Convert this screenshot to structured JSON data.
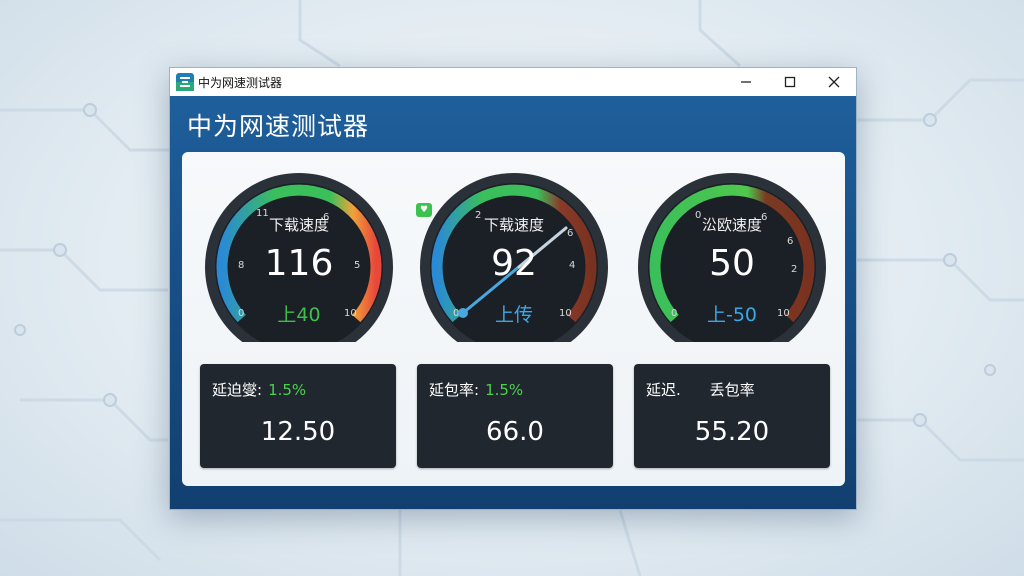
{
  "window": {
    "title": "中为网速测试器",
    "controls": [
      "minimize",
      "maximize",
      "close"
    ]
  },
  "app": {
    "heading": "中为网速测试器"
  },
  "gauges": [
    {
      "label": "下载速度",
      "value": "116",
      "sub_label": "上40",
      "sub_color": "#3fbf4a",
      "ticks": [
        "11",
        "6",
        "8",
        "5",
        "0",
        "10"
      ]
    },
    {
      "label": "下载速度",
      "value": "92",
      "sub_label": "上传",
      "sub_color": "#3aa7e6",
      "ticks": [
        "2",
        "6",
        "4",
        "0",
        "10"
      ]
    },
    {
      "label": "㳂欧速度",
      "value": "50",
      "sub_label": "上-50",
      "sub_color": "#3aa7e6",
      "ticks": [
        "0",
        "6",
        "6",
        "2",
        "0",
        "10"
      ]
    }
  ],
  "status_badge": {
    "icon": "heart-icon"
  },
  "cards": [
    {
      "label": "延迫燮:",
      "pct": "1.5%",
      "value": "12.50"
    },
    {
      "label": "延包率:",
      "pct": "1.5%",
      "value": "66.0"
    },
    {
      "label": "延迟.",
      "label2": "丢包率",
      "value": "55.20"
    }
  ]
}
